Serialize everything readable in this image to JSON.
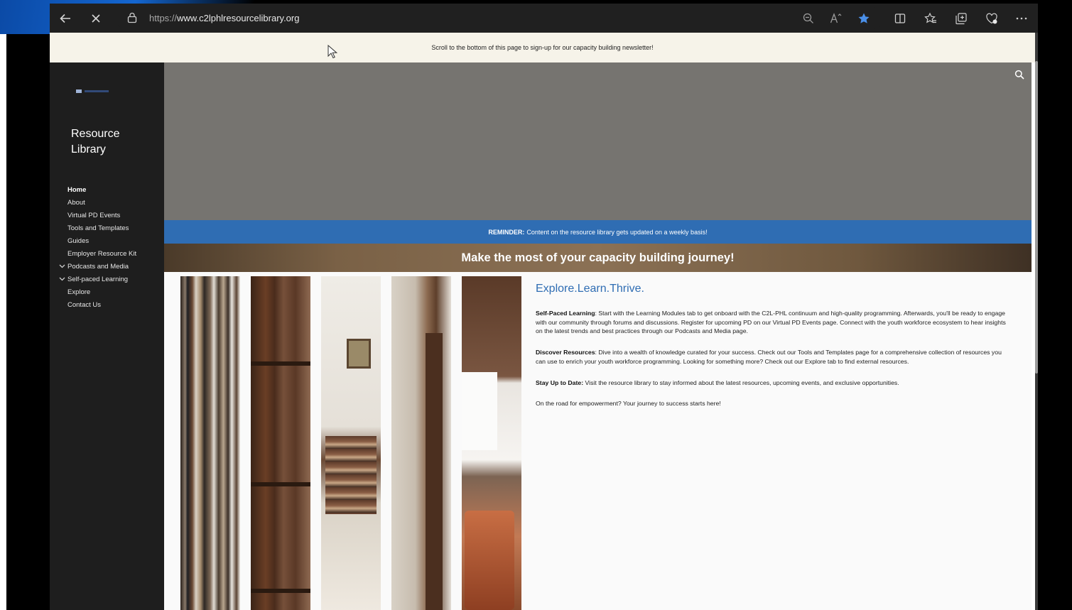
{
  "browser": {
    "url_prefix": "https://",
    "url_host": "www.c2lphlresourcelibrary.org"
  },
  "page": {
    "announcement": "Scroll to the bottom of this page to sign-up for our capacity building newsletter!",
    "site_title": "Resource Library",
    "nav": [
      {
        "label": "Home"
      },
      {
        "label": "About"
      },
      {
        "label": "Virtual PD Events"
      },
      {
        "label": "Tools and Templates"
      },
      {
        "label": "Guides"
      },
      {
        "label": "Employer Resource Kit"
      },
      {
        "label": "Podcasts and Media"
      },
      {
        "label": "Self-paced Learning"
      },
      {
        "label": "Explore"
      },
      {
        "label": "Contact Us"
      }
    ],
    "reminder_label": "REMINDER:",
    "reminder_text": "Content on the resource library gets updated on a weekly basis!",
    "banner": "Make the most of your capacity building journey!",
    "tagline": "Explore.Learn.Thrive.",
    "sections": [
      {
        "heading": "Self-Paced Learning",
        "body": ": Start with the Learning Modules tab to get onboard with the C2L-PHL continuum and high-quality programming. Afterwards, you'll be ready to engage with our community through forums and discussions. Register for upcoming PD on our Virtual PD Events page. Connect with the youth workforce ecosystem to hear insights on the latest trends and best practices through our Podcasts and Media page."
      },
      {
        "heading": "Discover Resources",
        "body": ": Dive into a wealth of knowledge curated for your success. Check out our Tools and Templates page for a comprehensive collection of resources you can use to enrich your youth workforce programming. Looking for something more? Check out our Explore tab to find external resources."
      },
      {
        "heading": "Stay Up to Date:",
        "body": " Visit the resource library to stay informed about the latest resources, upcoming events, and exclusive opportunities."
      }
    ],
    "closing": "On the road for empowerment? Your journey to success starts here!"
  }
}
